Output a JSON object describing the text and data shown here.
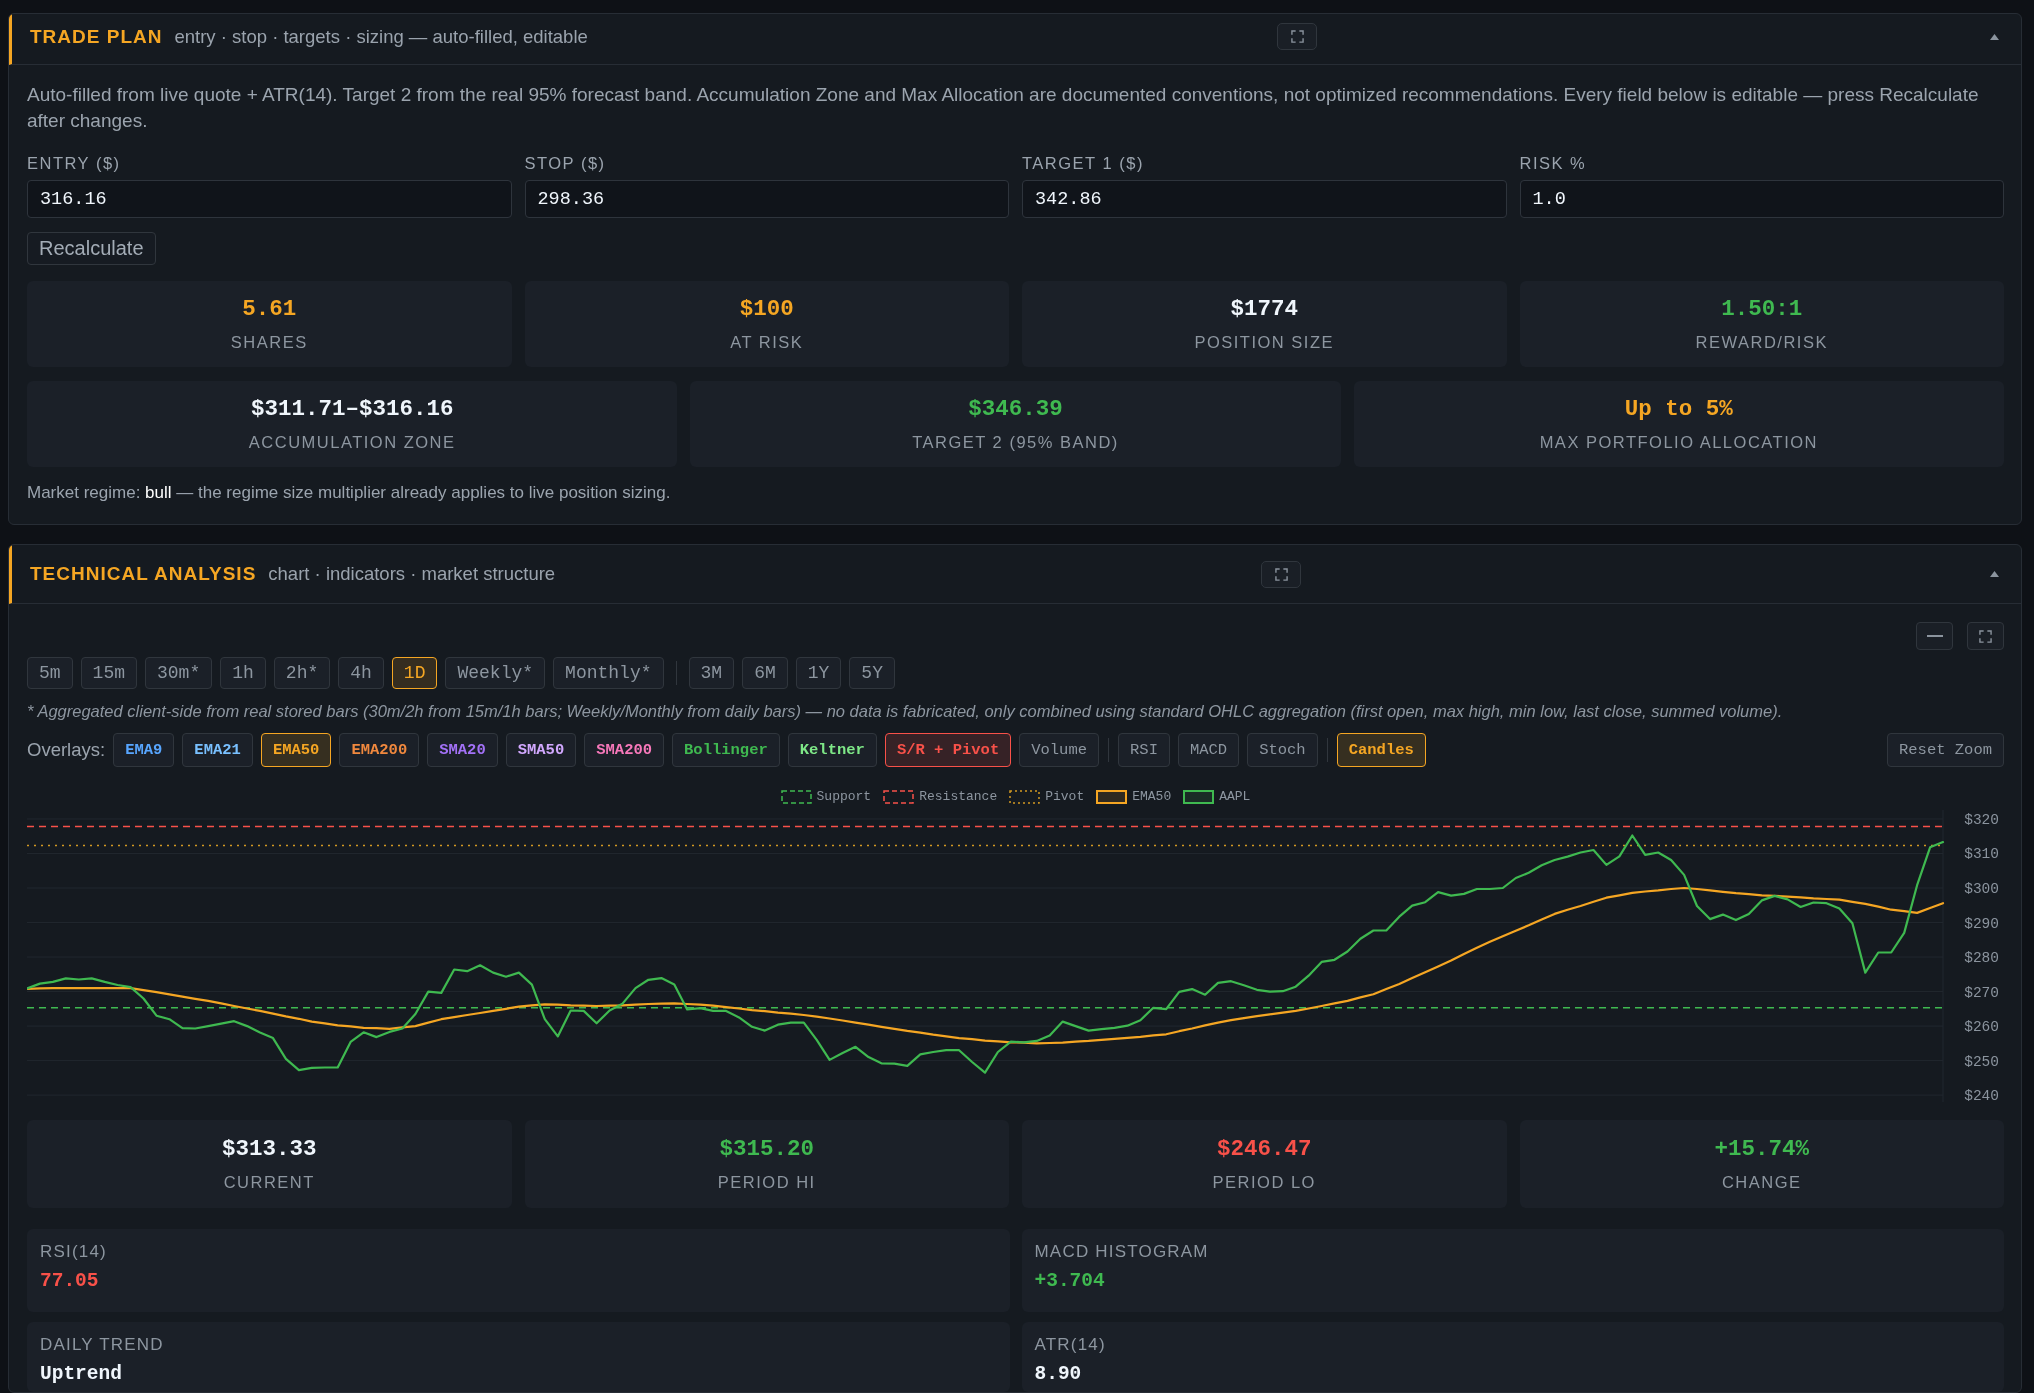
{
  "trade_plan": {
    "title": "TRADE PLAN",
    "subtitle": "entry · stop · targets · sizing — auto-filled, editable",
    "expanded": true,
    "description": "Auto-filled from live quote + ATR(14). Target 2 from the real 95% forecast band. Accumulation Zone and Max Allocation are documented conventions, not optimized recommendations. Every field below is editable — press Recalculate after changes.",
    "fields": [
      {
        "label": "ENTRY ($)",
        "value": "316.16"
      },
      {
        "label": "STOP ($)",
        "value": "298.36"
      },
      {
        "label": "TARGET 1 ($)",
        "value": "342.86"
      },
      {
        "label": "RISK %",
        "value": "1.0"
      }
    ],
    "recalculate_button": "Recalculate",
    "stats": [
      {
        "value": "5.61",
        "label": "SHARES",
        "color": "#f5a623"
      },
      {
        "value": "$100",
        "label": "AT RISK",
        "color": "#f5a623"
      },
      {
        "value": "$1774",
        "label": "POSITION SIZE",
        "color": "#f0f6fc"
      },
      {
        "value": "1.50:1",
        "label": "REWARD/RISK",
        "color": "#3fb950"
      }
    ],
    "zone_stats": [
      {
        "value": "$311.71–$316.16",
        "label": "ACCUMULATION ZONE",
        "color": "#f0f6fc"
      },
      {
        "value": "$346.39",
        "label": "TARGET 2 (95% BAND)",
        "color": "#3fb950"
      },
      {
        "value": "Up to 5%",
        "label": "MAX PORTFOLIO ALLOCATION",
        "color": "#f5a623"
      }
    ],
    "regime_note": "Market regime: **bull** — the regime size multiplier already applies to live position sizing."
  },
  "technical_analysis": {
    "title": "TECHNICAL ANALYSIS",
    "subtitle": "chart · indicators · market structure",
    "expanded": true,
    "timeframe_groups": [
      [
        {
          "label": "5m",
          "selected": false
        },
        {
          "label": "15m",
          "selected": false
        },
        {
          "label": "30m*",
          "selected": false
        },
        {
          "label": "1h",
          "selected": false
        },
        {
          "label": "2h*",
          "selected": false
        },
        {
          "label": "4h",
          "selected": false
        },
        {
          "label": "1D",
          "selected": true
        },
        {
          "label": "Weekly*",
          "selected": false
        },
        {
          "label": "Monthly*",
          "selected": false
        }
      ],
      [
        {
          "label": "3M",
          "selected": false
        },
        {
          "label": "6M",
          "selected": false
        },
        {
          "label": "1Y",
          "selected": false
        },
        {
          "label": "5Y",
          "selected": false
        }
      ]
    ],
    "aggregation_note": "* Aggregated client-side from real stored bars (30m/2h from 15m/1h bars; Weekly/Monthly from daily bars) — no data is fabricated, only combined using standard OHLC aggregation (first open, max high, min low, last close, summed volume).",
    "overlays_label": "Overlays:",
    "overlay_groups": [
      [
        {
          "label": "EMA9",
          "color": "#58a6ff",
          "selected": false
        },
        {
          "label": "EMA21",
          "color": "#79c0ff",
          "selected": false
        },
        {
          "label": "EMA50",
          "color": "#f5a623",
          "selected": true
        },
        {
          "label": "EMA200",
          "color": "#f0883e",
          "selected": false
        },
        {
          "label": "SMA20",
          "color": "#a371f7",
          "selected": false
        },
        {
          "label": "SMA50",
          "color": "#d2a8ff",
          "selected": false
        },
        {
          "label": "SMA200",
          "color": "#f778ba",
          "selected": false
        },
        {
          "label": "Bollinger",
          "color": "#3fb950",
          "selected": false
        },
        {
          "label": "Keltner",
          "color": "#7ee787",
          "selected": false
        },
        {
          "label": "S/R + Pivot",
          "color": "#f85149",
          "selected": true
        },
        {
          "label": "Volume",
          "selected": false
        }
      ],
      [
        {
          "label": "RSI",
          "selected": false
        },
        {
          "label": "MACD",
          "selected": false
        },
        {
          "label": "Stoch",
          "selected": false
        }
      ],
      [
        {
          "label": "Candles",
          "color": "#f5a623",
          "selected": true
        }
      ]
    ],
    "reset_zoom_button": "Reset Zoom",
    "chart_data": [
      {
        "type": "line",
        "legend": "top",
        "grid": true,
        "tick_labels": "y",
        "ylim": [
          238,
          322.6
        ],
        "yticks": [
          {
            "value": 240,
            "label": "$240"
          },
          {
            "value": 250,
            "label": "$250"
          },
          {
            "value": 260,
            "label": "$260"
          },
          {
            "value": 270,
            "label": "$270"
          },
          {
            "value": 280,
            "label": "$280"
          },
          {
            "value": 290,
            "label": "$290"
          },
          {
            "value": 300,
            "label": "$300"
          },
          {
            "value": 310,
            "label": "$310"
          },
          {
            "value": 320,
            "label": "$320"
          }
        ],
        "ref_lines": [
          {
            "axis": "y",
            "value": 265.3,
            "label": "Support",
            "color": "#3fb950",
            "line_style": "dashed"
          },
          {
            "axis": "y",
            "value": 317.8,
            "label": "Resistance",
            "color": "#f85149",
            "line_style": "dashed"
          },
          {
            "axis": "y",
            "value": 312.3,
            "label": "Pivot",
            "color": "#d29922",
            "line_style": "dotted"
          }
        ],
        "series": [
          {
            "name": "EMA50",
            "color": "#f5a623",
            "values": [
              270.8,
              270.9,
              271,
              271,
              271,
              271,
              271,
              271,
              271,
              270.4,
              269.8,
              269.2,
              268.5,
              267.9,
              267.3,
              266.6,
              265.8,
              265.1,
              264.4,
              263.6,
              262.8,
              262.1,
              261.3,
              260.8,
              260.2,
              259.9,
              259.5,
              259.4,
              259.2,
              259.6,
              260,
              261,
              262,
              262.6,
              263.2,
              263.8,
              264.4,
              265,
              265.6,
              266,
              266.3,
              266.2,
              266,
              265.9,
              265.8,
              265.9,
              266,
              266.2,
              266.4,
              266.5,
              266.6,
              266.4,
              266.2,
              265.9,
              265.5,
              265.1,
              264.6,
              264.3,
              263.9,
              263.6,
              263.2,
              262.7,
              262.2,
              261.6,
              261,
              260.4,
              259.8,
              259.2,
              258.6,
              258.1,
              257.5,
              257,
              256.5,
              256.2,
              255.8,
              255.6,
              255.3,
              255.2,
              255,
              255.1,
              255.2,
              255.5,
              255.7,
              256,
              256.3,
              256.6,
              256.9,
              257.3,
              257.6,
              258.5,
              259.3,
              260.2,
              261,
              261.7,
              262.3,
              262.9,
              263.4,
              263.9,
              264.4,
              265.1,
              265.8,
              266.6,
              267.3,
              268.3,
              269.2,
              270.7,
              272.2,
              273.9,
              275.6,
              277.3,
              279,
              280.9,
              282.7,
              284.4,
              286,
              287.6,
              289.2,
              290.9,
              292.5,
              293.7,
              294.8,
              296,
              297.2,
              297.9,
              298.6,
              299,
              299.3,
              299.7,
              300,
              299.7,
              299.3,
              298.9,
              298.5,
              298.2,
              297.9,
              297.7,
              297.5,
              297.3,
              297,
              296.8,
              296.6,
              296,
              295.4,
              294.6,
              293.7,
              293.3,
              292.8,
              294.2,
              295.6
            ]
          },
          {
            "name": "AAPL",
            "color": "#3fb950",
            "values": [
              270.9,
              272.3,
              272.8,
              273.8,
              273.5,
              273.8,
              272.8,
              271.9,
              271.3,
              268,
              263,
              262,
              259.4,
              259.3,
              260,
              260.7,
              261.4,
              260,
              258.1,
              256.5,
              250.5,
              247.2,
              247.9,
              248,
              248,
              255.4,
              258.2,
              256.8,
              258.3,
              259.3,
              263.5,
              270,
              269.6,
              276.4,
              275.9,
              277.6,
              275.5,
              274.3,
              275.5,
              272,
              262,
              257,
              264.5,
              264.4,
              260.8,
              264.5,
              266.5,
              271,
              273.4,
              273.9,
              272,
              264.8,
              265.2,
              264.4,
              264.4,
              262.5,
              259.8,
              258.7,
              260.4,
              261,
              261,
              256,
              250.2,
              252.2,
              254,
              251,
              249.2,
              249.1,
              248.5,
              251.8,
              252.5,
              253,
              253,
              249.6,
              246.5,
              252.5,
              255.5,
              255.3,
              255.7,
              257.3,
              261.3,
              260,
              258.7,
              259.1,
              259.5,
              260.1,
              261.7,
              265.3,
              264.9,
              269.9,
              270.7,
              269.1,
              272.5,
              273,
              271.8,
              270.5,
              270,
              270.1,
              271.4,
              274.6,
              278.6,
              279.2,
              281.6,
              285.3,
              287.7,
              287.7,
              291.7,
              294.9,
              295.9,
              298.8,
              297.8,
              298.3,
              299.7,
              299.7,
              300,
              302.9,
              304.4,
              306.6,
              308.1,
              309.1,
              310.3,
              311,
              306.7,
              309.2,
              315.2,
              309.6,
              310.3,
              308.1,
              303.8,
              294.8,
              291,
              292.3,
              290.7,
              292.5,
              296.4,
              297.7,
              296.7,
              294.5,
              295.8,
              295.6,
              294.1,
              289.8,
              275.5,
              281.3,
              281.3,
              287,
              300.8,
              311.8,
              313.3
            ]
          }
        ]
      }
    ],
    "stats": [
      {
        "value": "$313.33",
        "label": "CURRENT",
        "color": "#f0f6fc"
      },
      {
        "value": "$315.20",
        "label": "PERIOD HI",
        "color": "#3fb950"
      },
      {
        "value": "$246.47",
        "label": "PERIOD LO",
        "color": "#f85149"
      },
      {
        "value": "+15.74%",
        "label": "CHANGE",
        "color": "#3fb950"
      }
    ],
    "indicators": [
      {
        "label": "RSI(14)",
        "value": "77.05",
        "color": "#f85149"
      },
      {
        "label": "MACD HISTOGRAM",
        "value": "+3.704",
        "color": "#3fb950"
      },
      {
        "label": "DAILY TREND",
        "value": "Uptrend",
        "color": "#f0f6fc"
      },
      {
        "label": "ATR(14)",
        "value": "8.90",
        "color": "#f0f6fc"
      }
    ]
  }
}
